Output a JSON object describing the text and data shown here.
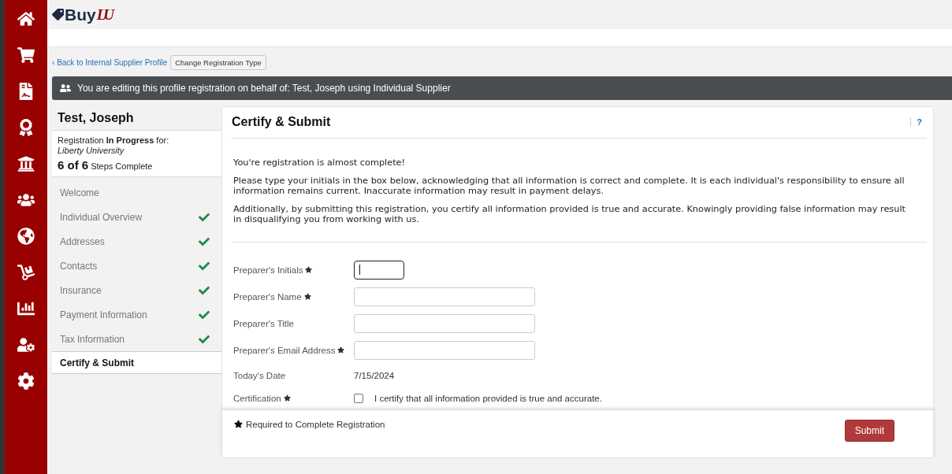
{
  "logo": {
    "word": "Buy",
    "mark": "LU"
  },
  "back_link": {
    "chevron": "‹",
    "label": "Back to Internal Supplier Profile"
  },
  "change_type_button": "Change Registration Type",
  "banner": "You are editing this profile registration on behalf of: Test, Joseph using Individual Supplier",
  "sidebar": {
    "name": "Test, Joseph",
    "status": "Registration **In Progress** for:",
    "organization": "Liberty University",
    "progress": {
      "count": "6 of 6",
      "label": "Steps Complete"
    },
    "steps": [
      {
        "label": "Welcome",
        "complete": false,
        "selected": false
      },
      {
        "label": "Individual Overview",
        "complete": true,
        "selected": false
      },
      {
        "label": "Addresses",
        "complete": true,
        "selected": false
      },
      {
        "label": "Contacts",
        "complete": true,
        "selected": false
      },
      {
        "label": "Insurance",
        "complete": true,
        "selected": false
      },
      {
        "label": "Payment Information",
        "complete": true,
        "selected": false
      },
      {
        "label": "Tax Information",
        "complete": true,
        "selected": false
      },
      {
        "label": "Certify & Submit",
        "complete": false,
        "selected": true
      }
    ]
  },
  "panel": {
    "title": "Certify & Submit",
    "help": "?",
    "paragraphs": [
      "You're registration is almost complete!",
      "Please type your initials in the box below, acknowledging that all information is correct and complete. It is each individual's responsibility to ensure all information remains current. Inaccurate information may result in payment delays.",
      "Additionally, by submitting this registration, you certify all information provided is true and accurate. Knowingly providing false information may result in disqualifying you from working with us."
    ],
    "fields": [
      {
        "kind": "initials",
        "label": "Preparer's Initials",
        "required": true,
        "focused": true
      },
      {
        "kind": "input",
        "label": "Preparer's Name",
        "required": true,
        "focused": false
      },
      {
        "kind": "input",
        "label": "Preparer's Title",
        "required": false,
        "focused": false
      },
      {
        "kind": "input",
        "label": "Preparer's Email Address",
        "required": true,
        "focused": false
      },
      {
        "kind": "text",
        "label": "Today's Date",
        "required": false,
        "value": "7/15/2024"
      },
      {
        "kind": "checkbox",
        "label": "Certification",
        "required": true,
        "checked": false,
        "text": "I certify that all information provided is true and accurate."
      }
    ],
    "footer_note": "Required to Complete Registration",
    "submit": "Submit"
  }
}
